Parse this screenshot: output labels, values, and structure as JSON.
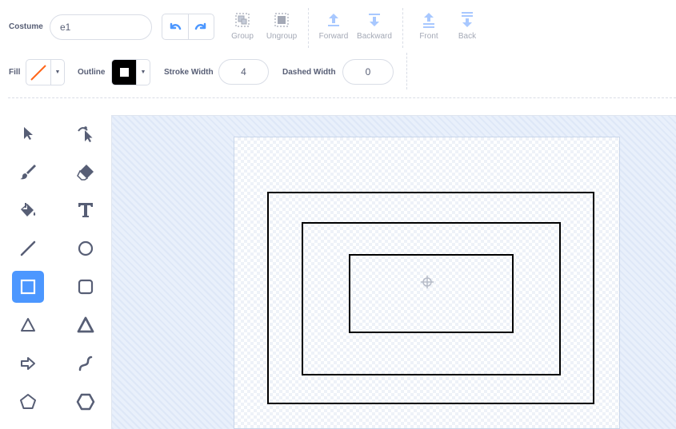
{
  "toolbar": {
    "costume_label": "Costume",
    "costume_name": "e1",
    "undo_icon": "undo-icon",
    "redo_icon": "redo-icon",
    "group_label": "Group",
    "ungroup_label": "Ungroup",
    "forward_label": "Forward",
    "backward_label": "Backward",
    "front_label": "Front",
    "back_label": "Back"
  },
  "style_bar": {
    "fill_label": "Fill",
    "outline_label": "Outline",
    "stroke_width_label": "Stroke Width",
    "stroke_width_value": "4",
    "dashed_width_label": "Dashed Width",
    "dashed_width_value": "0",
    "fill_color": "none",
    "outline_color": "#000000"
  },
  "tools": [
    {
      "name": "select-icon"
    },
    {
      "name": "reshape-icon"
    },
    {
      "name": "brush-icon"
    },
    {
      "name": "eraser-icon"
    },
    {
      "name": "fill-icon"
    },
    {
      "name": "text-icon"
    },
    {
      "name": "line-icon"
    },
    {
      "name": "circle-icon"
    },
    {
      "name": "rectangle-icon",
      "active": true
    },
    {
      "name": "rounded-rectangle-icon"
    },
    {
      "name": "triangle-icon"
    },
    {
      "name": "triangle-bold-icon"
    },
    {
      "name": "arrow-icon"
    },
    {
      "name": "curve-icon"
    },
    {
      "name": "pentagon-icon"
    },
    {
      "name": "hexagon-icon"
    }
  ],
  "colors": {
    "accent": "#4c97ff",
    "text": "#575e75",
    "disabled": "#a4a9b6",
    "fill_slash": "#ff661a"
  }
}
